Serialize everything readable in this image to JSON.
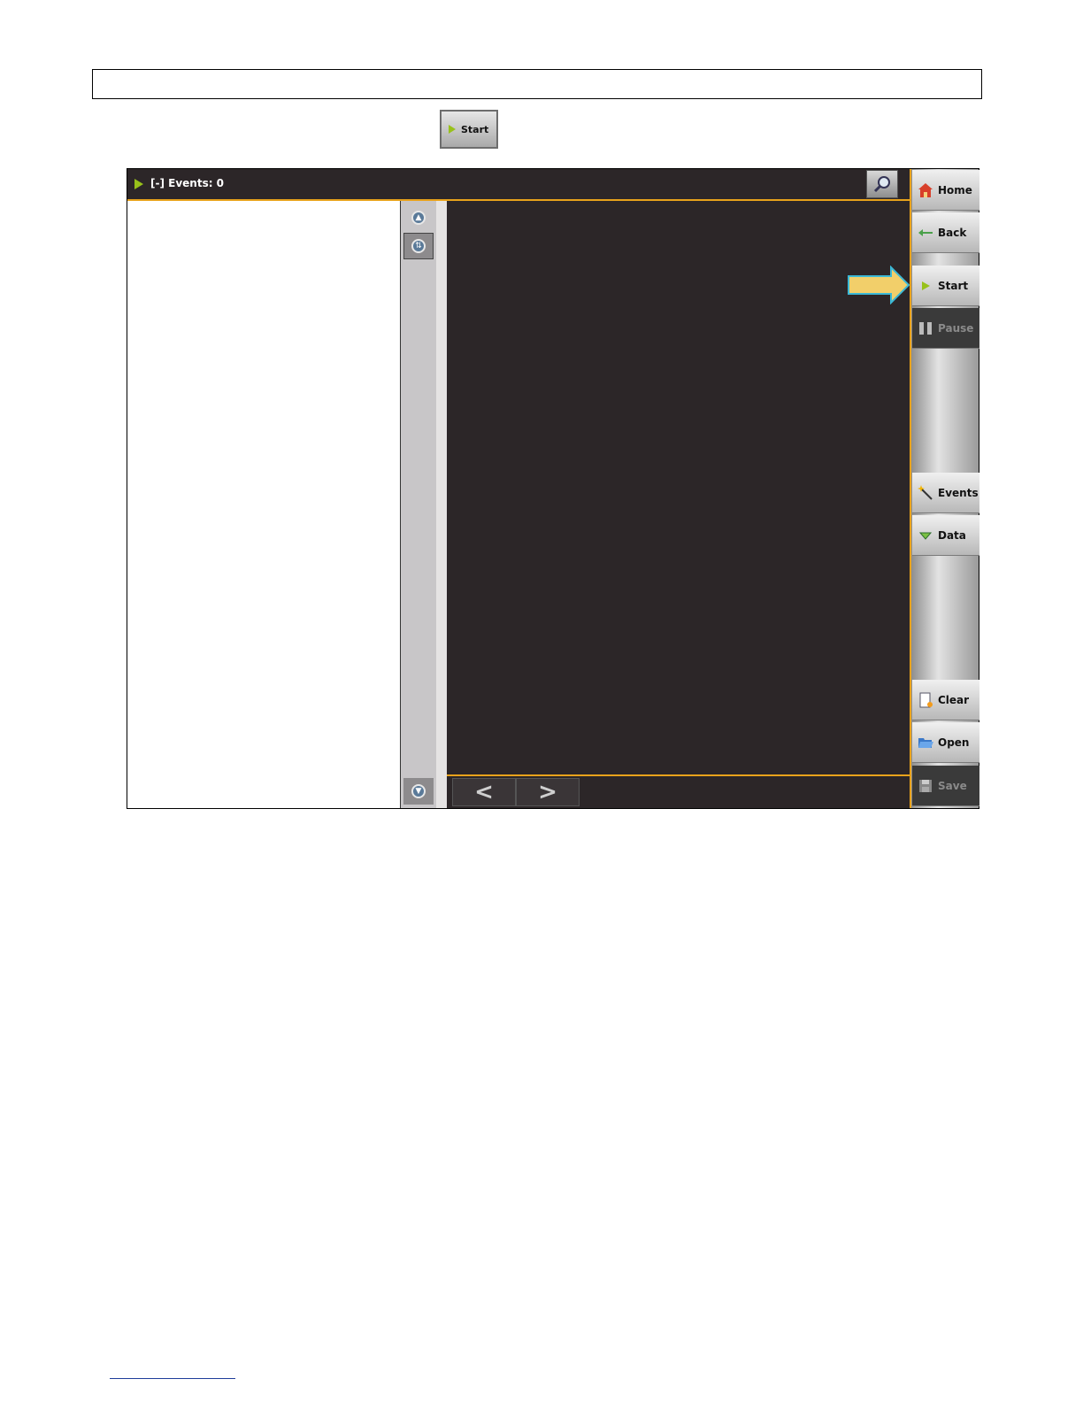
{
  "inline_button": {
    "label": "Start"
  },
  "window": {
    "title": "[-] Events: 0"
  },
  "sidebar": {
    "items": [
      {
        "label": "Home",
        "icon": "home-icon",
        "enabled": true
      },
      {
        "label": "Back",
        "icon": "back-arrow-icon",
        "enabled": true
      },
      {
        "label": "Start",
        "icon": "play-icon",
        "enabled": true
      },
      {
        "label": "Pause",
        "icon": "pause-icon",
        "enabled": false
      },
      {
        "label": "Events",
        "icon": "magic-wand-icon",
        "enabled": true
      },
      {
        "label": "Data",
        "icon": "triangle-down-icon",
        "enabled": true
      },
      {
        "label": "Clear",
        "icon": "clear-document-icon",
        "enabled": true
      },
      {
        "label": "Open",
        "icon": "folder-open-icon",
        "enabled": true
      },
      {
        "label": "Save",
        "icon": "floppy-disk-icon",
        "enabled": false
      }
    ]
  },
  "nav": {
    "prev": "<",
    "next": ">"
  },
  "colors": {
    "accent": "#e8a21b",
    "dark": "#2c2628",
    "play_green": "#98c11a",
    "arrow_fill": "#f2cf6a",
    "arrow_border": "#3bb8d6"
  }
}
